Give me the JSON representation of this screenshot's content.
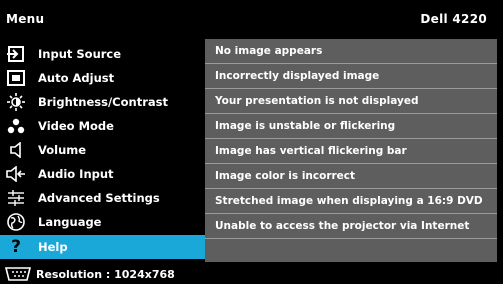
{
  "header": {
    "title": "Menu",
    "model": "Dell 4220"
  },
  "menu": [
    {
      "label": "Input Source",
      "icon": "input-source-icon"
    },
    {
      "label": "Auto Adjust",
      "icon": "auto-adjust-icon"
    },
    {
      "label": "Brightness/Contrast",
      "icon": "brightness-icon"
    },
    {
      "label": "Video Mode",
      "icon": "video-mode-icon"
    },
    {
      "label": "Volume",
      "icon": "volume-icon"
    },
    {
      "label": "Audio Input",
      "icon": "audio-input-icon"
    },
    {
      "label": "Advanced Settings",
      "icon": "advanced-settings-icon"
    },
    {
      "label": "Language",
      "icon": "language-icon"
    },
    {
      "label": "Help",
      "icon": "help-icon",
      "selected": true
    }
  ],
  "help_items": [
    "No image appears",
    "Incorrectly displayed image",
    "Your presentation is not displayed",
    "Image is unstable or flickering",
    "Image has vertical flickering bar",
    "Image color is incorrect",
    "Stretched image when displaying a 16:9 DVD",
    "Unable to access the projector via Internet"
  ],
  "status": {
    "resolution": "Resolution : 1024x768",
    "icon": "display-port-icon"
  },
  "colors": {
    "selected": "#1aa8d8",
    "panel": "#5e5e5e",
    "background": "#000000"
  }
}
